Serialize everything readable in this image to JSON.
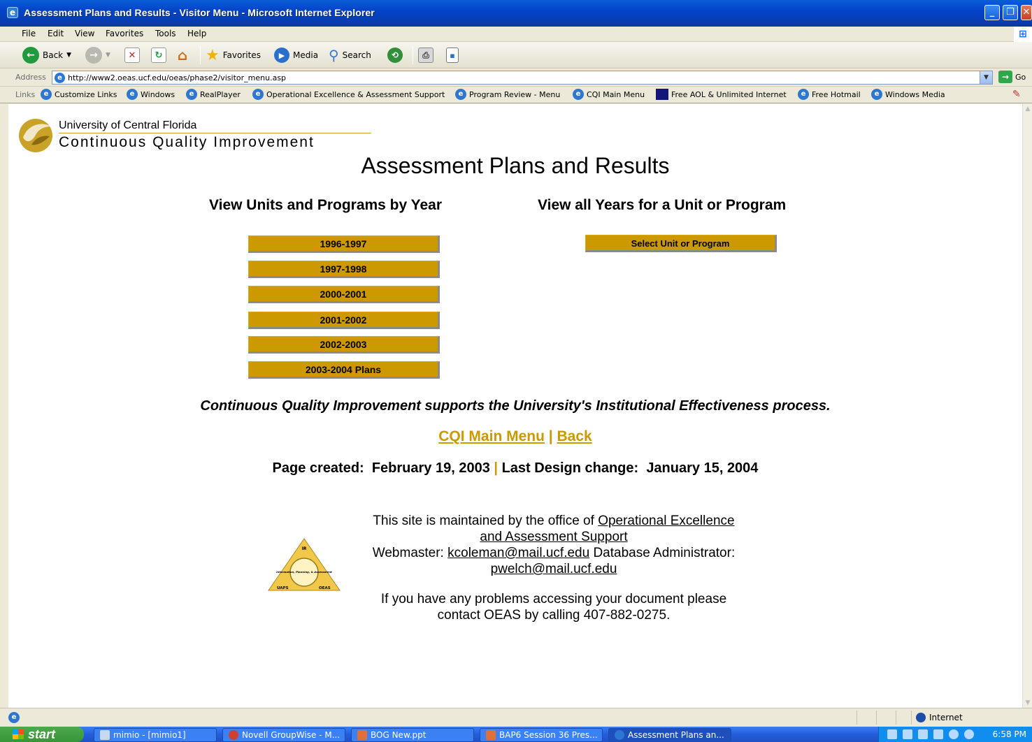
{
  "window": {
    "title": "Assessment Plans and Results - Visitor Menu - Microsoft Internet Explorer"
  },
  "menu": [
    "File",
    "Edit",
    "View",
    "Favorites",
    "Tools",
    "Help"
  ],
  "toolbar": {
    "back": "Back",
    "favorites": "Favorites",
    "media": "Media",
    "search": "Search"
  },
  "address": {
    "label": "Address",
    "url": "http://www2.oeas.ucf.edu/oeas/phase2/visitor_menu.asp",
    "go": "Go"
  },
  "links": {
    "label": "Links",
    "items": [
      "Customize Links",
      "Windows",
      "RealPlayer",
      "Operational Excellence & Assessment Support",
      "Program Review - Menu",
      "CQI Main Menu",
      "Free AOL & Unlimited Internet",
      "Free Hotmail",
      "Windows Media"
    ]
  },
  "page": {
    "university": "University of Central Florida",
    "program": "Continuous Quality Improvement",
    "title": "Assessment Plans and Results",
    "col_year_heading": "View Units and Programs by Year",
    "col_unit_heading": "View all Years for a Unit or Program",
    "years": [
      "1996-1997",
      "1997-1998",
      "2000-2001",
      "2001-2002",
      "2002-2003",
      "2003-2004 Plans"
    ],
    "select_unit": "Select Unit or Program",
    "tagline": "Continuous Quality Improvement supports the University's Institutional Effectiveness process.",
    "nav": {
      "main_menu": "CQI Main Menu",
      "sep": "|",
      "back": "Back"
    },
    "created_label": "Page created:",
    "created_date": "February 19, 2003",
    "design_label": "Last Design change:",
    "design_date": "January 15, 2004",
    "maint_prefix": "This site is maintained by the office of",
    "maint_office_1": "Operational Excellence",
    "maint_office_2": "and Assessment Support",
    "webmaster_label": "Webmaster:",
    "webmaster_email": "kcoleman@mail.ucf.edu",
    "dba_label": "Database Administrator:",
    "dba_email": "pwelch@mail.ucf.edu",
    "problem_line1": "If you have any problems accessing your document please",
    "problem_line2": "contact OEAS by calling 407-882-0275.",
    "oeas_logo_labels": [
      "IR",
      "Information, Planning, & Assessment",
      "UAPS",
      "OEAS"
    ]
  },
  "status": {
    "zone": "Internet"
  },
  "taskbar": {
    "start": "start",
    "tasks": [
      "mimio - [mimio1]",
      "Novell GroupWise - M...",
      "BOG New.ppt",
      "BAP6 Session 36 Pres...",
      "Assessment Plans an..."
    ],
    "clock": "6:58 PM"
  },
  "colors": {
    "gold": "#cc9900",
    "xp_blue": "#0343c9"
  }
}
